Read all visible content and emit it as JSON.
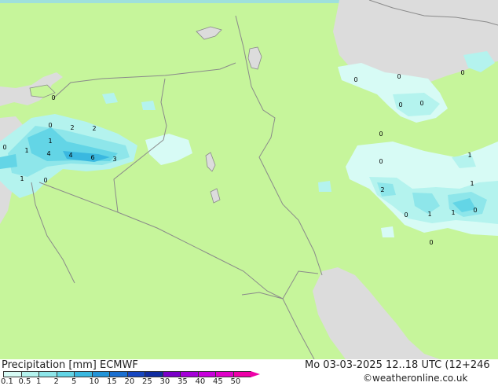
{
  "title": "Precipitation [mm]",
  "model": "ECMWF",
  "valid_time": "Mo 03-03-2025 12..18 UTC (12+246",
  "credit": "©weatheronline.co.uk",
  "legend": {
    "ticks": [
      "0.1",
      "0.5",
      "1",
      "2",
      "5",
      "10",
      "15",
      "20",
      "25",
      "30",
      "35",
      "40",
      "45",
      "50"
    ],
    "colors": [
      "#d7fbf5",
      "#b4f3ee",
      "#8ee6ea",
      "#63d5e6",
      "#3ab8e0",
      "#2294d8",
      "#1a6fd0",
      "#1646c0",
      "#102ca0",
      "#7a00c8",
      "#a400d8",
      "#c800dc",
      "#e000c8",
      "#ee00a8"
    ]
  },
  "map": {
    "land_color": "#c6f59b",
    "sea_color": "#dcdcdc",
    "border_color": "#8a8a8a",
    "point_labels": [
      {
        "id": "p1",
        "text": "1"
      },
      {
        "id": "p2",
        "text": "2"
      },
      {
        "id": "p3",
        "text": "2"
      },
      {
        "id": "p4",
        "text": "0"
      },
      {
        "id": "p5",
        "text": "0"
      },
      {
        "id": "p6",
        "text": "1"
      },
      {
        "id": "p7",
        "text": "4"
      },
      {
        "id": "p8",
        "text": "4"
      },
      {
        "id": "p9",
        "text": "6"
      },
      {
        "id": "p10",
        "text": "3"
      },
      {
        "id": "p11",
        "text": "1"
      },
      {
        "id": "p12",
        "text": "0"
      },
      {
        "id": "p13",
        "text": "0"
      },
      {
        "id": "p14",
        "text": "0"
      },
      {
        "id": "p15",
        "text": "0"
      },
      {
        "id": "p16",
        "text": "0"
      },
      {
        "id": "p17",
        "text": "0"
      },
      {
        "id": "p18",
        "text": "0"
      },
      {
        "id": "p19",
        "text": "0"
      },
      {
        "id": "p20",
        "text": "1"
      },
      {
        "id": "p21",
        "text": "2"
      },
      {
        "id": "p22",
        "text": "1"
      },
      {
        "id": "p23",
        "text": "0"
      },
      {
        "id": "p24",
        "text": "1"
      },
      {
        "id": "p25",
        "text": "1"
      },
      {
        "id": "p26",
        "text": "0"
      },
      {
        "id": "p27",
        "text": "0"
      },
      {
        "id": "p28",
        "text": "0"
      }
    ]
  }
}
